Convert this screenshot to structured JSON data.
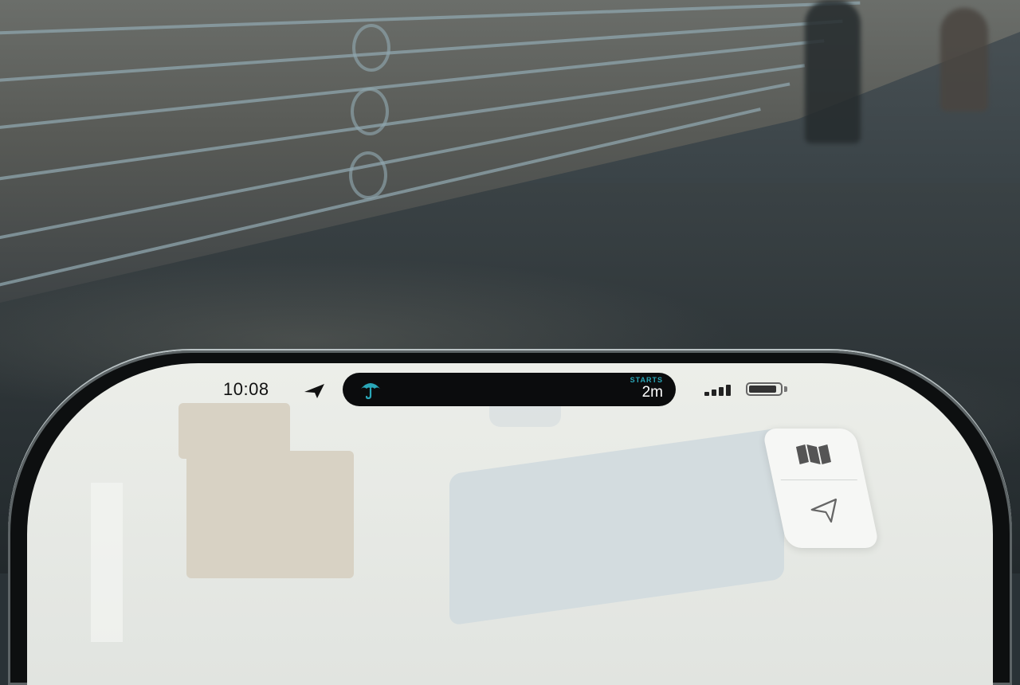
{
  "status_bar": {
    "time": "10:08",
    "location_icon": "location-arrow-icon",
    "signal_icon": "cellular-signal-icon",
    "battery_icon": "battery-icon"
  },
  "dynamic_island": {
    "icon": "umbrella-icon",
    "label": "STARTS",
    "value": "2m",
    "accent_color": "#2aa7b8"
  },
  "map_controls": {
    "map_button_icon": "map-icon",
    "location_button_icon": "location-arrow-icon"
  }
}
